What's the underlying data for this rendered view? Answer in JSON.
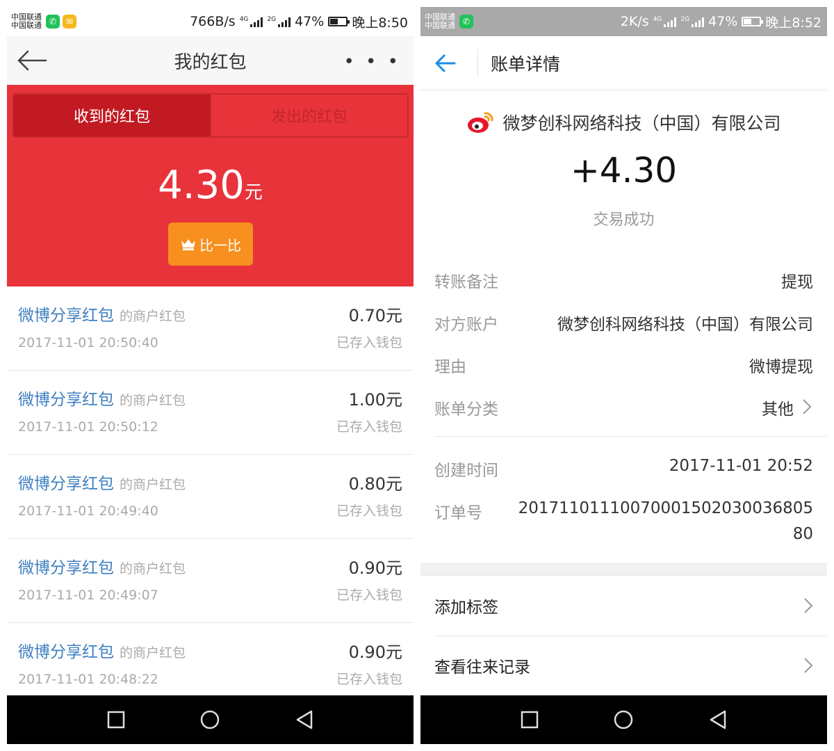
{
  "left": {
    "statusbar": {
      "carrier1": "中国联通",
      "carrier2": "中国联通",
      "speed": "766B/s",
      "net1": "4G",
      "net2": "2G",
      "battery": "47%",
      "time": "晚上8:50"
    },
    "header": {
      "title": "我的红包",
      "more": "• • •"
    },
    "tabs": {
      "received": "收到的红包",
      "sent": "发出的红包"
    },
    "total": {
      "amount": "4.30",
      "unit": "元"
    },
    "compare_button": "比一比",
    "items": [
      {
        "title": "微博分享红包",
        "subtitle": "的商户红包",
        "date": "2017-11-01 20:50:40",
        "amount": "0.70元",
        "status": "已存入钱包"
      },
      {
        "title": "微博分享红包",
        "subtitle": "的商户红包",
        "date": "2017-11-01 20:50:12",
        "amount": "1.00元",
        "status": "已存入钱包"
      },
      {
        "title": "微博分享红包",
        "subtitle": "的商户红包",
        "date": "2017-11-01 20:49:40",
        "amount": "0.80元",
        "status": "已存入钱包"
      },
      {
        "title": "微博分享红包",
        "subtitle": "的商户红包",
        "date": "2017-11-01 20:49:07",
        "amount": "0.90元",
        "status": "已存入钱包"
      },
      {
        "title": "微博分享红包",
        "subtitle": "的商户红包",
        "date": "2017-11-01 20:48:22",
        "amount": "0.90元",
        "status": "已存入钱包"
      }
    ]
  },
  "right": {
    "statusbar": {
      "carrier1": "中国联通",
      "carrier2": "中国联通",
      "speed": "2K/s",
      "net1": "4G",
      "net2": "2G",
      "battery": "47%",
      "time": "晚上8:52"
    },
    "header": {
      "title": "账单详情"
    },
    "company": "微梦创科网络科技（中国）有限公司",
    "amount": "+4.30",
    "status": "交易成功",
    "details": {
      "memo": {
        "label": "转账备注",
        "value": "提现"
      },
      "counterparty": {
        "label": "对方账户",
        "value": "微梦创科网络科技（中国）有限公司"
      },
      "reason": {
        "label": "理由",
        "value": "微博提现"
      },
      "category": {
        "label": "账单分类",
        "value": "其他"
      },
      "created": {
        "label": "创建时间",
        "value": "2017-11-01 20:52"
      },
      "order": {
        "label": "订单号",
        "value_line1": "20171101110070001502030036805",
        "value_line2": "80"
      }
    },
    "actions": {
      "add_tag": "添加标签",
      "history": "查看往来记录"
    }
  },
  "colors": {
    "red": "#e8333b",
    "dark_red": "#c21a22",
    "orange": "#f7901e",
    "link_blue": "#3f7fc1",
    "back_blue": "#1a8ee8"
  }
}
